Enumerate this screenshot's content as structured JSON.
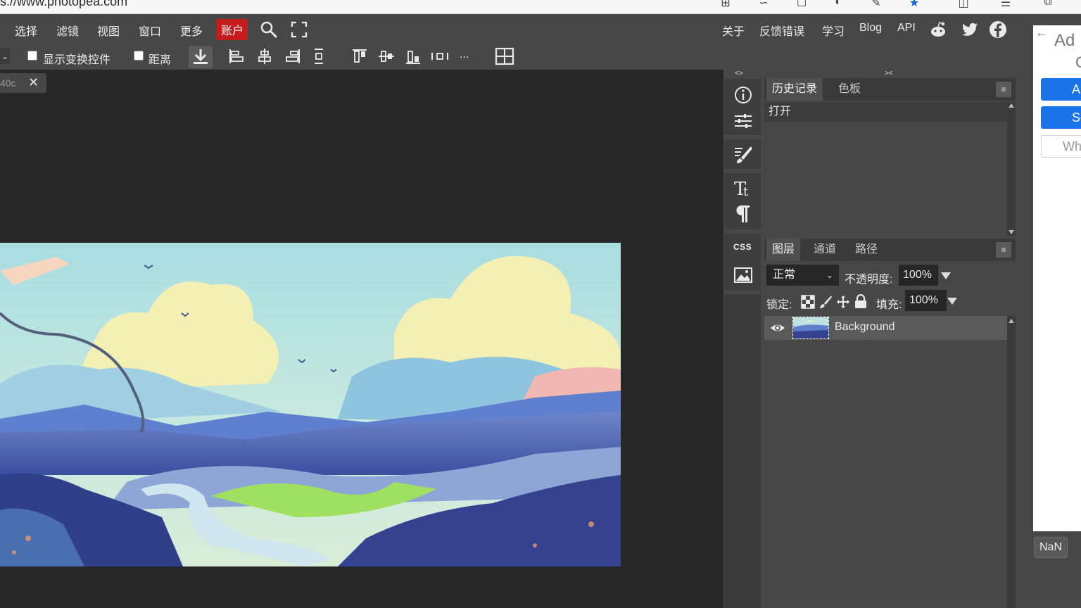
{
  "browser": {
    "url": "s://www.photopea.com"
  },
  "menubar": {
    "items": [
      "选择",
      "滤镜",
      "视图",
      "窗口",
      "更多"
    ],
    "account_label": "账户",
    "right_links": [
      "关于",
      "反馈错误",
      "学习",
      "Blog",
      "API"
    ]
  },
  "options": {
    "show_transform_label": "显示变换控件",
    "distance_label": "距离",
    "more_label": "..."
  },
  "document": {
    "tab_name": "40c",
    "close_glyph": "✕"
  },
  "toolstrip": {
    "collapse_glyph": "<>",
    "css_label": "CSS"
  },
  "history_panel": {
    "collapse_glyph": "><",
    "tabs": [
      "历史记录",
      "色板"
    ],
    "menu_glyph": "≡",
    "entries": [
      "打开"
    ]
  },
  "layers_panel": {
    "tabs": [
      "图层",
      "通道",
      "路径"
    ],
    "menu_glyph": "≡",
    "blend_mode": "正常",
    "opacity_label": "不透明度:",
    "opacity_value": "100%",
    "lock_label": "锁定:",
    "fill_label": "填充:",
    "fill_value": "100%",
    "layers": [
      {
        "name": "Background",
        "visible": true
      }
    ]
  },
  "ad_panel": {
    "back_glyph": "←",
    "title": "Ad",
    "sub": "C",
    "btn1": "A",
    "btn2": "Se",
    "btn3": "Wh"
  },
  "nan_button": "NaN",
  "colors": {
    "account_red": "#c61c1c",
    "panel_bg": "#474747",
    "canvas_bg": "#282828",
    "ad_blue": "#1a73e8"
  }
}
